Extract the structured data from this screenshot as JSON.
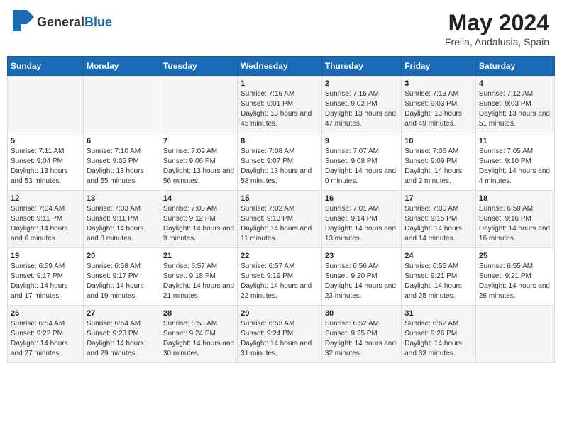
{
  "app": {
    "logo_general": "General",
    "logo_blue": "Blue",
    "title": "May 2024",
    "subtitle": "Freila, Andalusia, Spain"
  },
  "calendar": {
    "days_of_week": [
      "Sunday",
      "Monday",
      "Tuesday",
      "Wednesday",
      "Thursday",
      "Friday",
      "Saturday"
    ],
    "weeks": [
      [
        {
          "day": "",
          "sunrise": "",
          "sunset": "",
          "daylight": ""
        },
        {
          "day": "",
          "sunrise": "",
          "sunset": "",
          "daylight": ""
        },
        {
          "day": "",
          "sunrise": "",
          "sunset": "",
          "daylight": ""
        },
        {
          "day": "1",
          "sunrise": "Sunrise: 7:16 AM",
          "sunset": "Sunset: 9:01 PM",
          "daylight": "Daylight: 13 hours and 45 minutes."
        },
        {
          "day": "2",
          "sunrise": "Sunrise: 7:15 AM",
          "sunset": "Sunset: 9:02 PM",
          "daylight": "Daylight: 13 hours and 47 minutes."
        },
        {
          "day": "3",
          "sunrise": "Sunrise: 7:13 AM",
          "sunset": "Sunset: 9:03 PM",
          "daylight": "Daylight: 13 hours and 49 minutes."
        },
        {
          "day": "4",
          "sunrise": "Sunrise: 7:12 AM",
          "sunset": "Sunset: 9:03 PM",
          "daylight": "Daylight: 13 hours and 51 minutes."
        }
      ],
      [
        {
          "day": "5",
          "sunrise": "Sunrise: 7:11 AM",
          "sunset": "Sunset: 9:04 PM",
          "daylight": "Daylight: 13 hours and 53 minutes."
        },
        {
          "day": "6",
          "sunrise": "Sunrise: 7:10 AM",
          "sunset": "Sunset: 9:05 PM",
          "daylight": "Daylight: 13 hours and 55 minutes."
        },
        {
          "day": "7",
          "sunrise": "Sunrise: 7:09 AM",
          "sunset": "Sunset: 9:06 PM",
          "daylight": "Daylight: 13 hours and 56 minutes."
        },
        {
          "day": "8",
          "sunrise": "Sunrise: 7:08 AM",
          "sunset": "Sunset: 9:07 PM",
          "daylight": "Daylight: 13 hours and 58 minutes."
        },
        {
          "day": "9",
          "sunrise": "Sunrise: 7:07 AM",
          "sunset": "Sunset: 9:08 PM",
          "daylight": "Daylight: 14 hours and 0 minutes."
        },
        {
          "day": "10",
          "sunrise": "Sunrise: 7:06 AM",
          "sunset": "Sunset: 9:09 PM",
          "daylight": "Daylight: 14 hours and 2 minutes."
        },
        {
          "day": "11",
          "sunrise": "Sunrise: 7:05 AM",
          "sunset": "Sunset: 9:10 PM",
          "daylight": "Daylight: 14 hours and 4 minutes."
        }
      ],
      [
        {
          "day": "12",
          "sunrise": "Sunrise: 7:04 AM",
          "sunset": "Sunset: 9:11 PM",
          "daylight": "Daylight: 14 hours and 6 minutes."
        },
        {
          "day": "13",
          "sunrise": "Sunrise: 7:03 AM",
          "sunset": "Sunset: 9:11 PM",
          "daylight": "Daylight: 14 hours and 8 minutes."
        },
        {
          "day": "14",
          "sunrise": "Sunrise: 7:03 AM",
          "sunset": "Sunset: 9:12 PM",
          "daylight": "Daylight: 14 hours and 9 minutes."
        },
        {
          "day": "15",
          "sunrise": "Sunrise: 7:02 AM",
          "sunset": "Sunset: 9:13 PM",
          "daylight": "Daylight: 14 hours and 11 minutes."
        },
        {
          "day": "16",
          "sunrise": "Sunrise: 7:01 AM",
          "sunset": "Sunset: 9:14 PM",
          "daylight": "Daylight: 14 hours and 13 minutes."
        },
        {
          "day": "17",
          "sunrise": "Sunrise: 7:00 AM",
          "sunset": "Sunset: 9:15 PM",
          "daylight": "Daylight: 14 hours and 14 minutes."
        },
        {
          "day": "18",
          "sunrise": "Sunrise: 6:59 AM",
          "sunset": "Sunset: 9:16 PM",
          "daylight": "Daylight: 14 hours and 16 minutes."
        }
      ],
      [
        {
          "day": "19",
          "sunrise": "Sunrise: 6:59 AM",
          "sunset": "Sunset: 9:17 PM",
          "daylight": "Daylight: 14 hours and 17 minutes."
        },
        {
          "day": "20",
          "sunrise": "Sunrise: 6:58 AM",
          "sunset": "Sunset: 9:17 PM",
          "daylight": "Daylight: 14 hours and 19 minutes."
        },
        {
          "day": "21",
          "sunrise": "Sunrise: 6:57 AM",
          "sunset": "Sunset: 9:18 PM",
          "daylight": "Daylight: 14 hours and 21 minutes."
        },
        {
          "day": "22",
          "sunrise": "Sunrise: 6:57 AM",
          "sunset": "Sunset: 9:19 PM",
          "daylight": "Daylight: 14 hours and 22 minutes."
        },
        {
          "day": "23",
          "sunrise": "Sunrise: 6:56 AM",
          "sunset": "Sunset: 9:20 PM",
          "daylight": "Daylight: 14 hours and 23 minutes."
        },
        {
          "day": "24",
          "sunrise": "Sunrise: 6:55 AM",
          "sunset": "Sunset: 9:21 PM",
          "daylight": "Daylight: 14 hours and 25 minutes."
        },
        {
          "day": "25",
          "sunrise": "Sunrise: 6:55 AM",
          "sunset": "Sunset: 9:21 PM",
          "daylight": "Daylight: 14 hours and 26 minutes."
        }
      ],
      [
        {
          "day": "26",
          "sunrise": "Sunrise: 6:54 AM",
          "sunset": "Sunset: 9:22 PM",
          "daylight": "Daylight: 14 hours and 27 minutes."
        },
        {
          "day": "27",
          "sunrise": "Sunrise: 6:54 AM",
          "sunset": "Sunset: 9:23 PM",
          "daylight": "Daylight: 14 hours and 29 minutes."
        },
        {
          "day": "28",
          "sunrise": "Sunrise: 6:53 AM",
          "sunset": "Sunset: 9:24 PM",
          "daylight": "Daylight: 14 hours and 30 minutes."
        },
        {
          "day": "29",
          "sunrise": "Sunrise: 6:53 AM",
          "sunset": "Sunset: 9:24 PM",
          "daylight": "Daylight: 14 hours and 31 minutes."
        },
        {
          "day": "30",
          "sunrise": "Sunrise: 6:52 AM",
          "sunset": "Sunset: 9:25 PM",
          "daylight": "Daylight: 14 hours and 32 minutes."
        },
        {
          "day": "31",
          "sunrise": "Sunrise: 6:52 AM",
          "sunset": "Sunset: 9:26 PM",
          "daylight": "Daylight: 14 hours and 33 minutes."
        },
        {
          "day": "",
          "sunrise": "",
          "sunset": "",
          "daylight": ""
        }
      ]
    ]
  }
}
